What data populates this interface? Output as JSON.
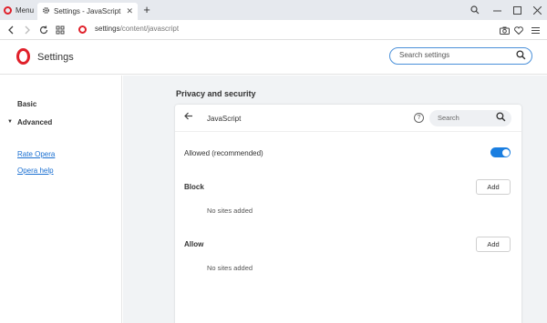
{
  "browser": {
    "menu_label": "Menu",
    "tab_title": "Settings - JavaScript",
    "url_host": "settings",
    "url_path": "/content/javascript"
  },
  "settings": {
    "title": "Settings",
    "search_placeholder": "Search settings"
  },
  "sidebar": {
    "basic": "Basic",
    "advanced": "Advanced",
    "rate": "Rate Opera",
    "help": "Opera help"
  },
  "main": {
    "section_title": "Privacy and security",
    "card_title": "JavaScript",
    "search_placeholder": "Search",
    "allowed_label": "Allowed (recommended)",
    "allowed_enabled": true,
    "block_label": "Block",
    "allow_label": "Allow",
    "add_label": "Add",
    "no_sites": "No sites added"
  },
  "colors": {
    "opera_red": "#e0202a",
    "accent_blue": "#1a7ee0",
    "link_blue": "#1a6fd1"
  }
}
